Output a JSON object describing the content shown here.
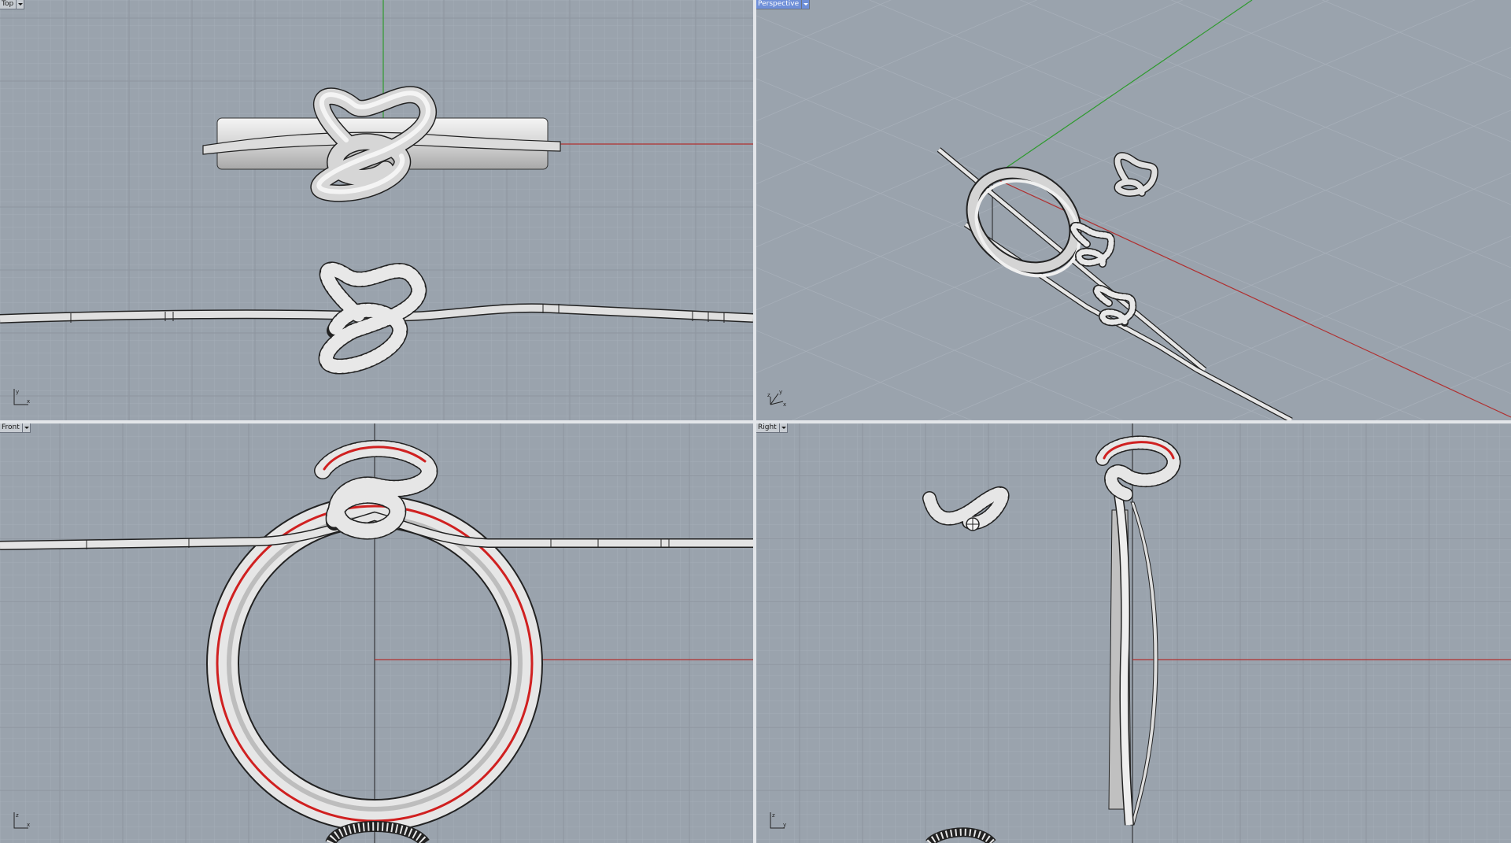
{
  "viewports": {
    "top": {
      "label": "Top"
    },
    "perspective": {
      "label": "Perspective"
    },
    "front": {
      "label": "Front"
    },
    "right": {
      "label": "Right"
    }
  },
  "axes": {
    "x": "x",
    "y": "y",
    "z": "z"
  },
  "colors": {
    "background": "#9aa3ad",
    "grid_minor": "#a6aeb8",
    "grid_major": "#8b939d",
    "x_axis": "#b03030",
    "y_axis": "#2f9a2f",
    "z_axis": "#1a1a1a",
    "metal_light": "#f2f2f2",
    "metal_mid": "#c9c9c9",
    "metal_dark": "#8a8a8a",
    "edge": "#222222",
    "highlight_red": "#d02020",
    "active_label": "#6f8fd8"
  },
  "icons": [
    "chevron-down-icon",
    "axes-indicator-icon"
  ]
}
